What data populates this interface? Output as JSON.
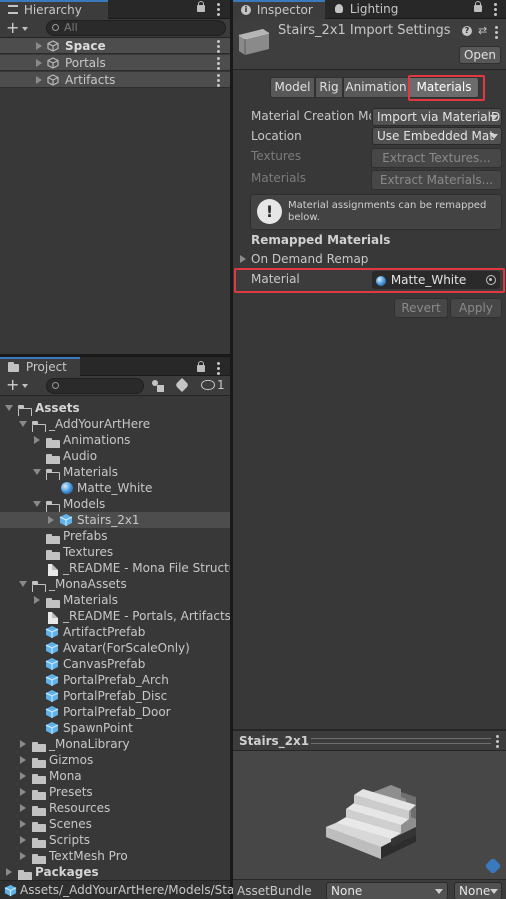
{
  "hierarchy": {
    "tab_label": "Hierarchy",
    "search_placeholder": "All",
    "items": [
      {
        "label": "Space"
      },
      {
        "label": "Portals"
      },
      {
        "label": "Artifacts"
      }
    ]
  },
  "project": {
    "tab_label": "Project",
    "hidden_count": "1",
    "tree": {
      "assets": "Assets",
      "add_your_art_here": "_AddYourArtHere",
      "animations": "Animations",
      "audio": "Audio",
      "materials": "Materials",
      "matte_white": "Matte_White",
      "models": "Models",
      "stairs": "Stairs_2x1",
      "prefabs": "Prefabs",
      "textures": "Textures",
      "readme_mona_file": "_README - Mona File Structu",
      "mona_assets": "_MonaAssets",
      "mona_materials": "Materials",
      "readme_portals": "_README - Portals, Artifacts &",
      "artifact_prefab": "ArtifactPrefab",
      "avatar": "Avatar(ForScaleOnly)",
      "canvas_prefab": "CanvasPrefab",
      "portal_arch": "PortalPrefab_Arch",
      "portal_disc": "PortalPrefab_Disc",
      "portal_door": "PortalPrefab_Door",
      "spawn_point": "SpawnPoint",
      "mona_library": "_MonaLibrary",
      "gizmos": "Gizmos",
      "mona": "Mona",
      "presets": "Presets",
      "resources": "Resources",
      "scenes": "Scenes",
      "scripts": "Scripts",
      "textmesh_pro": "TextMesh Pro",
      "packages": "Packages"
    },
    "path_bar": "Assets/_AddYourArtHere/Models/Sta"
  },
  "inspector": {
    "tab_inspector": "Inspector",
    "tab_lighting": "Lighting",
    "title": "Stairs_2x1 Import Settings",
    "open_button": "Open",
    "tabs": [
      {
        "label": "Model"
      },
      {
        "label": "Rig"
      },
      {
        "label": "Animation"
      },
      {
        "label": "Materials"
      }
    ],
    "material_creation_mode_label": "Material Creation Mo",
    "material_creation_mode_value": "Import via MaterialD",
    "location_label": "Location",
    "location_value": "Use Embedded Mat",
    "textures_label": "Textures",
    "extract_textures_button": "Extract Textures...",
    "materials_label": "Materials",
    "extract_materials_button": "Extract Materials...",
    "help_text": "Material assignments can be remapped below.",
    "remapped_heading": "Remapped Materials",
    "on_demand_remap": "On Demand Remap",
    "material_row_label": "Material",
    "material_row_value": "Matte_White",
    "revert_button": "Revert",
    "apply_button": "Apply",
    "preview_title": "Stairs_2x1",
    "asset_bundle_label": "AssetBundle",
    "asset_bundle_value": "None",
    "asset_bundle_variant": "None"
  },
  "colors": {
    "accent_blue": "#3a79bb",
    "highlight_red": "#e0393f",
    "panel_bg": "#383838"
  }
}
